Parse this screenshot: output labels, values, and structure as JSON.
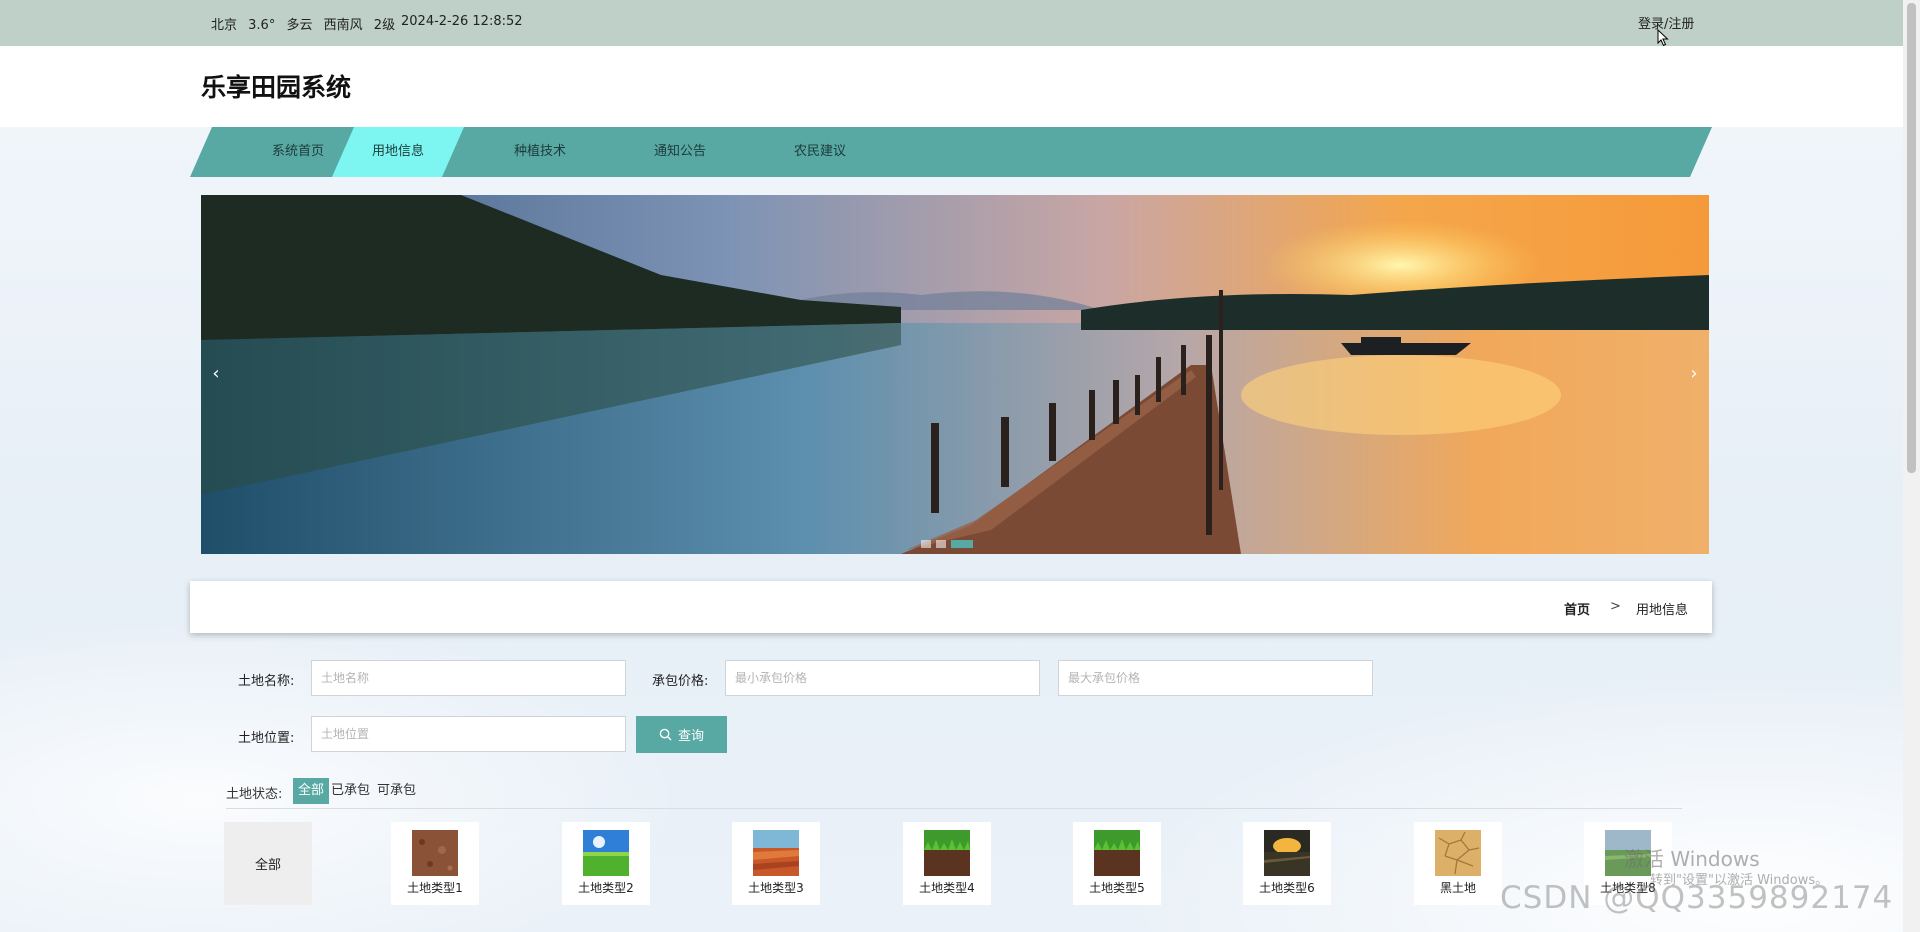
{
  "topbar": {
    "weather": {
      "city": "北京",
      "temperature": "3.6°",
      "condition": "多云",
      "wind": "西南风",
      "level": "2级"
    },
    "datetime": "2024-2-26 12:8:52",
    "login_label": "登录/注册"
  },
  "header": {
    "title": "乐享田园系统"
  },
  "nav": {
    "items": [
      {
        "label": "系统首页"
      },
      {
        "label": "用地信息"
      },
      {
        "label": "种植技术"
      },
      {
        "label": "通知公告"
      },
      {
        "label": "农民建议"
      }
    ],
    "active_index": 1
  },
  "banner": {
    "prev": "‹",
    "next": "›",
    "slides": 3,
    "active_slide": 2
  },
  "breadcrumb": {
    "home": "首页",
    "separator": ">",
    "current": "用地信息"
  },
  "search": {
    "name_label": "土地名称:",
    "name_placeholder": "土地名称",
    "price_label": "承包价格:",
    "min_price_placeholder": "最小承包价格",
    "max_price_placeholder": "最大承包价格",
    "location_label": "土地位置:",
    "location_placeholder": "土地位置",
    "query_label": "查询"
  },
  "status_filter": {
    "label": "土地状态:",
    "options": [
      {
        "label": "全部",
        "active": true
      },
      {
        "label": "已承包",
        "active": false
      },
      {
        "label": "可承包",
        "active": false
      }
    ]
  },
  "categories": {
    "all_label": "全部",
    "items": [
      {
        "label": "土地类型1",
        "icon": "brown-soil-thumbnail"
      },
      {
        "label": "土地类型2",
        "icon": "green-field-sky-thumbnail"
      },
      {
        "label": "土地类型3",
        "icon": "red-soil-thumbnail"
      },
      {
        "label": "土地类型4",
        "icon": "grass-soil-thumbnail"
      },
      {
        "label": "土地类型5",
        "icon": "grass-soil-thumbnail"
      },
      {
        "label": "土地类型6",
        "icon": "dark-field-sunset-thumbnail"
      },
      {
        "label": "黑土地",
        "icon": "dry-cracked-soil-thumbnail"
      },
      {
        "label": "土地类型8",
        "icon": "field-thumbnail"
      }
    ]
  },
  "overlay": {
    "activate_title": "激活 Windows",
    "activate_sub": "转到\"设置\"以激活 Windows。",
    "csdn": "CSDN @QQ3359892174"
  },
  "colors": {
    "topbar": "#bfd0c9",
    "nav": "#58a8a4",
    "nav_active": "#7df5f1",
    "accent": "#58a8a4"
  }
}
